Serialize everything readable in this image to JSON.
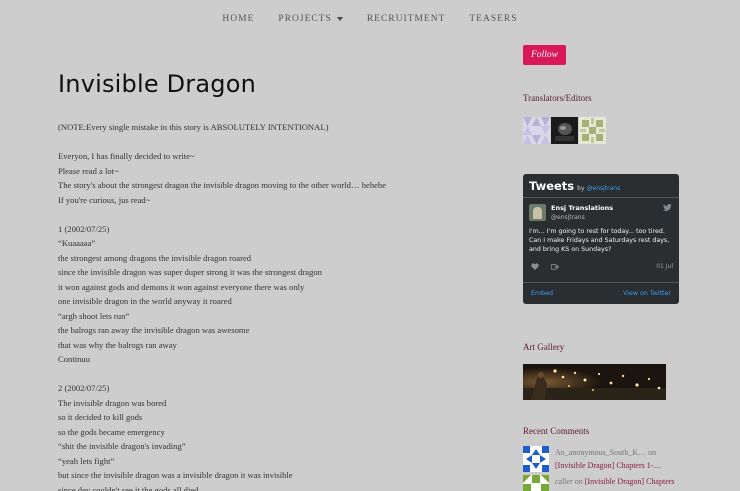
{
  "nav": {
    "items": [
      {
        "label": "HOME",
        "has_dropdown": false
      },
      {
        "label": "PROJECTS",
        "has_dropdown": true
      },
      {
        "label": "RECRUITMENT",
        "has_dropdown": false
      },
      {
        "label": "TEASERS",
        "has_dropdown": false
      }
    ]
  },
  "post": {
    "title": "Invisible Dragon",
    "note": "(NOTE:Every single mistake in this story is ABSOLUTELY INTENTIONAL)",
    "intro": [
      "Everyon, I has finally decided to write~",
      "Please read a lot~",
      "The story's about the strongest dragon the invisible dragon moving to the other world… hehehe",
      "If you're curious, jus read~"
    ],
    "chapter1": [
      "1 (2002/07/25)",
      "“Kuaaaaa”",
      "the strongest among dragons the invisible dragon roared",
      "since the invisible dragon was super duper strong it was the strongest dragon",
      "it won against gods and demons it won against everyone there was only",
      "one invisible dragon in the world anyway it roared",
      "“argh shoot lets run”",
      "the balrogs ran away the invisible dragon was awesome",
      "that was why the balrogs ran away",
      "Continuu"
    ],
    "chapter2": [
      "2 (2002/07/25)",
      "The invisible dragon was bored",
      "so it decided to kill gods",
      "so the gods became emergency",
      "“shit the invisible dragon's invading”",
      "“yeah lets fight”",
      "but since the invisible dragon was a invisible dragon it was invisible",
      "since dey couldn't see it the gods all died"
    ]
  },
  "sidebar": {
    "follow_label": "Follow",
    "translators_title": "Translators/Editors",
    "tweets": {
      "header": "Tweets",
      "by": "by",
      "handle_link": "@ensjtrans",
      "user_name": "Ensj Translations",
      "user_handle": "@ensjtrans",
      "text": "I'm... I'm going to rest for today... too tired. Can I make Fridays and Saturdays rest days, and bring KS on Sundays?",
      "date": "01 Jul",
      "embed_label": "Embed",
      "view_label": "View on Twitter",
      "link_color": "#3a9ff2",
      "bg_color": "#2b2e31"
    },
    "gallery_title": "Art Gallery",
    "comments_title": "Recent Comments",
    "comments": [
      {
        "author": "An_anonymous_South_K…",
        "on": "on",
        "link": "[Invisible Dragon] Chapters 1-…"
      },
      {
        "author": "caller",
        "on": "on",
        "link": "[Invisible Dragon] Chapters"
      }
    ]
  },
  "colors": {
    "background": "#cdcdcd",
    "accent": "#d9185a",
    "widget_title": "#5a1a34"
  }
}
